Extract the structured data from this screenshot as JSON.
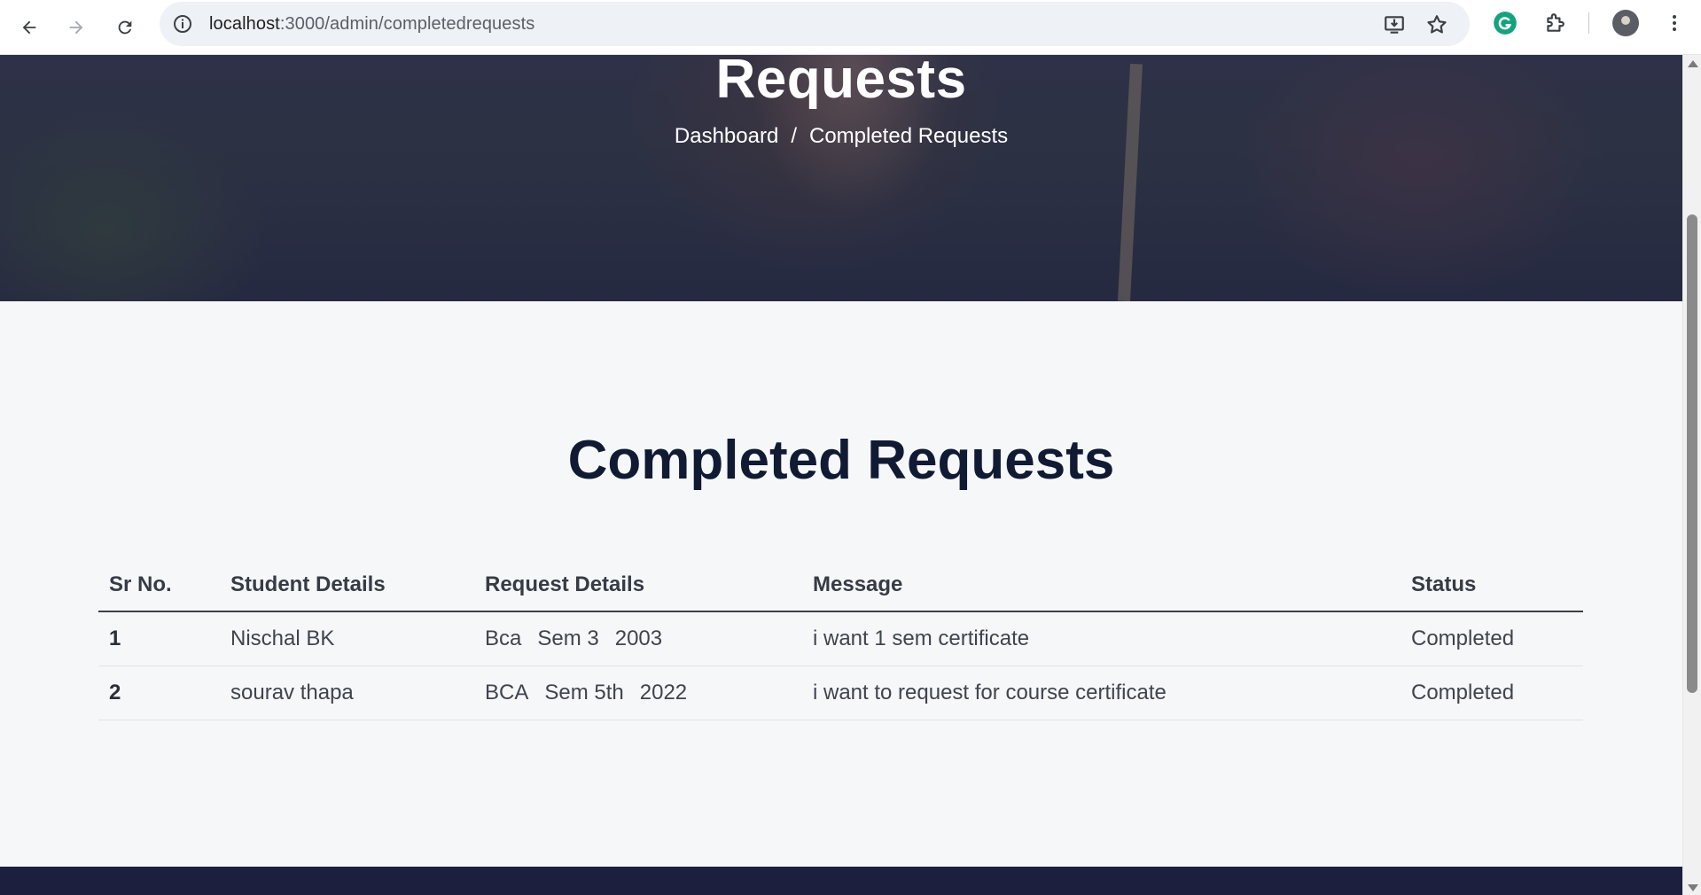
{
  "browser": {
    "url_host": "localhost",
    "url_path": ":3000/admin/completedrequests",
    "icons": [
      "back-arrow-icon",
      "forward-arrow-icon",
      "reload-icon",
      "site-info-icon",
      "install-app-icon",
      "bookmark-star-icon",
      "grammarly-icon",
      "extensions-icon",
      "profile-avatar",
      "more-menu-icon"
    ]
  },
  "hero": {
    "title": "Requests",
    "breadcrumb": {
      "home": "Dashboard",
      "separator": "/",
      "current": "Completed Requests"
    }
  },
  "main": {
    "title": "Completed Requests",
    "table": {
      "headers": [
        "Sr No.",
        "Student Details",
        "Request Details",
        "Message",
        "Status"
      ],
      "rows": [
        {
          "sr": "1",
          "student": "Nischal BK",
          "course": "Bca",
          "semester": "Sem 3",
          "year": "2003",
          "message": "i want 1 sem certificate",
          "status": "Completed"
        },
        {
          "sr": "2",
          "student": "sourav thapa",
          "course": "BCA",
          "semester": "Sem 5th",
          "year": "2022",
          "message": "i want to request for course certificate",
          "status": "Completed"
        }
      ]
    }
  },
  "colors": {
    "title_navy": "#111a33",
    "footer_navy": "#1c1f3d",
    "page_bg": "#f6f7f9"
  }
}
